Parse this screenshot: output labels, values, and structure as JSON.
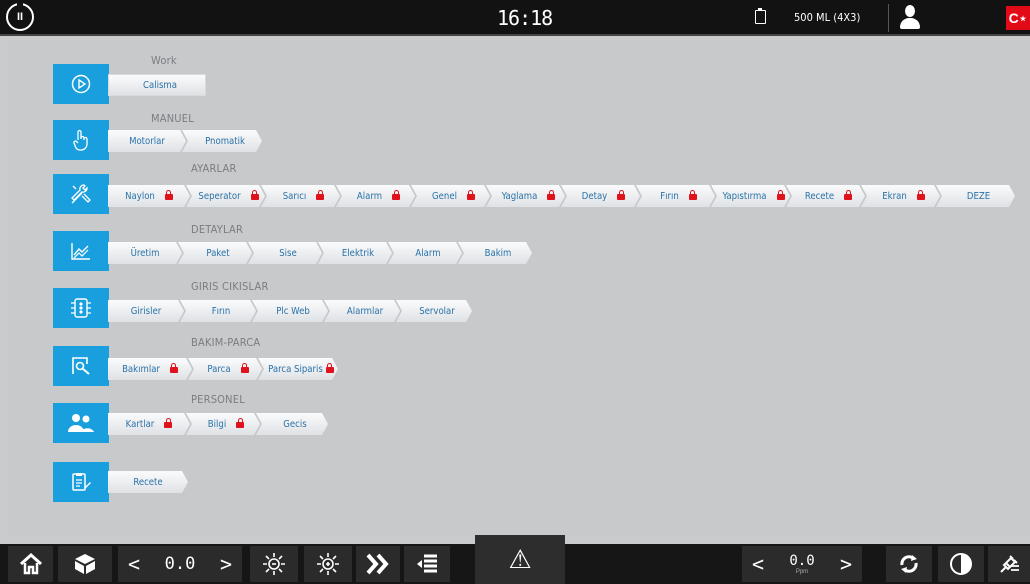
{
  "topbar": {
    "time": "16:18",
    "product": "500 ML  (4X3)",
    "flag_symbol": "C⋆"
  },
  "sections": [
    {
      "title": "Work",
      "icon": "play-icon",
      "items": [
        {
          "label": "Calisma",
          "locked": false
        }
      ]
    },
    {
      "title": "MANUEL",
      "icon": "hand-pointer-icon",
      "items": [
        {
          "label": "Motorlar",
          "locked": false
        },
        {
          "label": "Pnomatik",
          "locked": false
        }
      ]
    },
    {
      "title": "AYARLAR",
      "icon": "tools-icon",
      "items": [
        {
          "label": "Naylon",
          "locked": true
        },
        {
          "label": "Seperator",
          "locked": true
        },
        {
          "label": "Sarıcı",
          "locked": true
        },
        {
          "label": "Alarm",
          "locked": true
        },
        {
          "label": "Genel",
          "locked": true
        },
        {
          "label": "Yaglama",
          "locked": true
        },
        {
          "label": "Detay",
          "locked": true
        },
        {
          "label": "Fırın",
          "locked": true
        },
        {
          "label": "Yapıstırma",
          "locked": true
        },
        {
          "label": "Recete",
          "locked": true
        },
        {
          "label": "Ekran",
          "locked": true
        },
        {
          "label": "DEZE",
          "locked": false
        }
      ]
    },
    {
      "title": "DETAYLAR",
      "icon": "chart-icon",
      "items": [
        {
          "label": "Üretim",
          "locked": false
        },
        {
          "label": "Paket",
          "locked": false
        },
        {
          "label": "Sise",
          "locked": false
        },
        {
          "label": "Elektrik",
          "locked": false
        },
        {
          "label": "Alarm",
          "locked": false
        },
        {
          "label": "Bakim",
          "locked": false
        }
      ]
    },
    {
      "title": "GIRIS CIKISLAR",
      "icon": "io-module-icon",
      "items": [
        {
          "label": "Girisler",
          "locked": false
        },
        {
          "label": "Fırın",
          "locked": false
        },
        {
          "label": "Plc Web",
          "locked": false
        },
        {
          "label": "Alarmlar",
          "locked": false
        },
        {
          "label": "Servolar",
          "locked": false
        }
      ]
    },
    {
      "title": "BAKIM-PARCA",
      "icon": "magnify-doc-icon",
      "items": [
        {
          "label": "Bakımlar",
          "locked": true
        },
        {
          "label": "Parca",
          "locked": true
        },
        {
          "label": "Parca Siparis",
          "locked": true
        }
      ]
    },
    {
      "title": "PERSONEL",
      "icon": "users-icon",
      "items": [
        {
          "label": "Kartlar",
          "locked": true
        },
        {
          "label": "Bilgi",
          "locked": true
        },
        {
          "label": "Gecis",
          "locked": false
        }
      ]
    },
    {
      "title": "",
      "icon": "recipe-icon",
      "items": [
        {
          "label": "Recete",
          "locked": false
        }
      ]
    }
  ],
  "bottombar": {
    "speed_left": "0.0",
    "speed_right": "0.0",
    "speed_unit": "Ppm",
    "alarm_symbol": "⚠"
  }
}
